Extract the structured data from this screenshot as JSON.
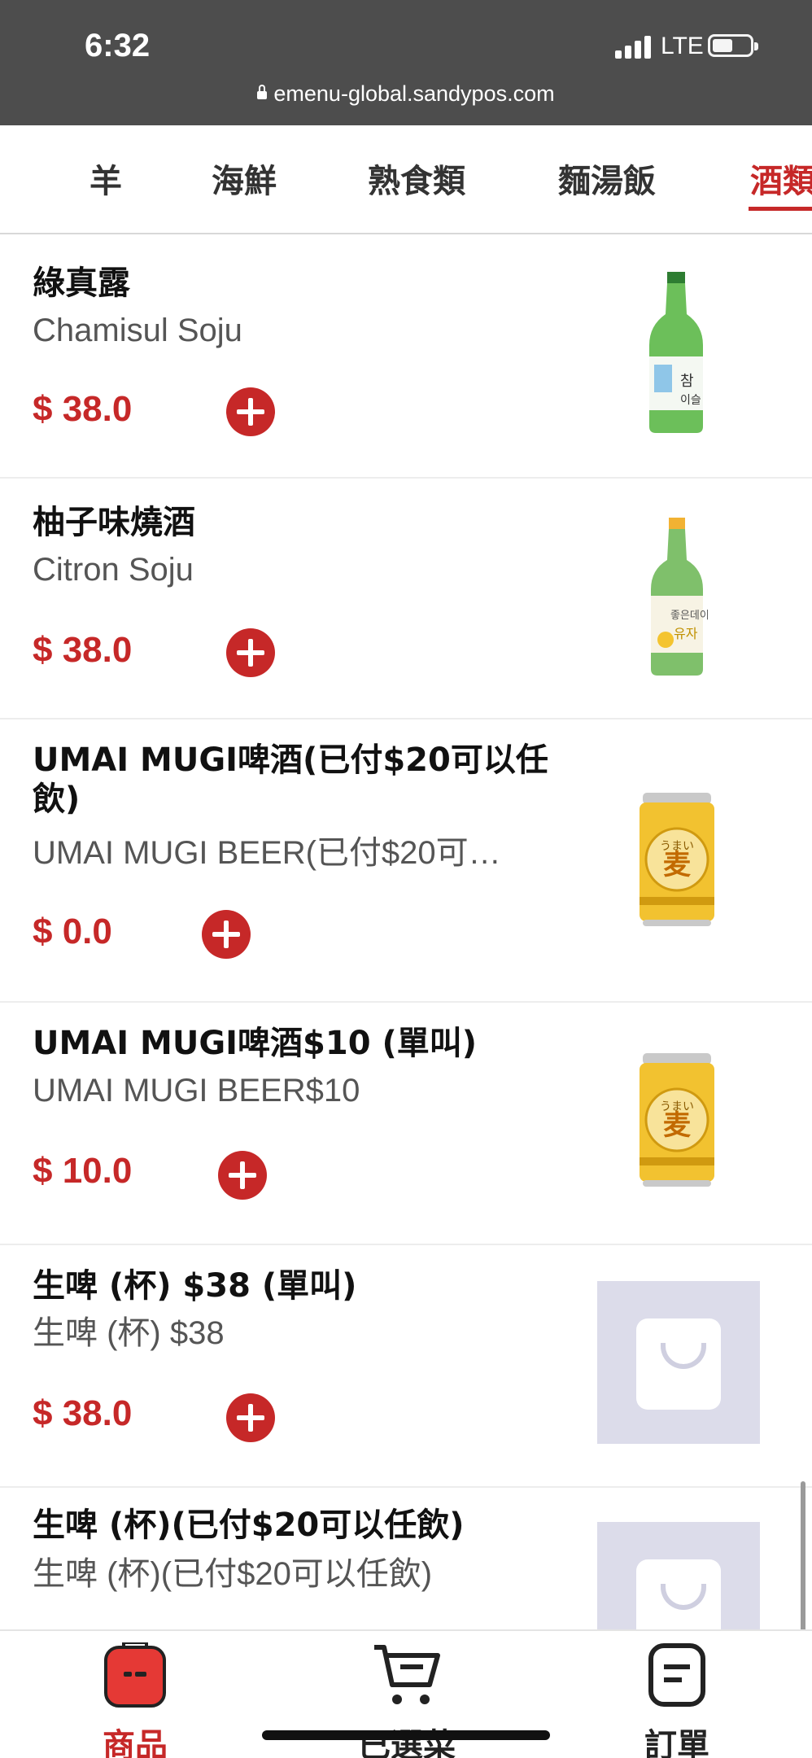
{
  "status_bar": {
    "time": "6:32",
    "network": "LTE",
    "url": "emenu-global.sandypos.com"
  },
  "tabs": [
    {
      "label": "羊"
    },
    {
      "label": "海鮮"
    },
    {
      "label": "熟食類"
    },
    {
      "label": "麵湯飯"
    },
    {
      "label": "酒類"
    }
  ],
  "active_tab": "酒類",
  "items": [
    {
      "name": "綠真露",
      "subname": "Chamisul Soju",
      "price": "$ 38.0",
      "image": "green-soju-bottle"
    },
    {
      "name": "柚子味燒酒",
      "subname": "Citron Soju",
      "price": "$ 38.0",
      "image": "citron-soju-bottle"
    },
    {
      "name": "UMAI MUGI啤酒(已付$20可以任飲)",
      "subname": "UMAI MUGI BEER(已付$20可…",
      "price": "$ 0.0",
      "image": "umai-mugi-beer-can"
    },
    {
      "name": "UMAI MUGI啤酒$10 (單叫)",
      "subname": "UMAI MUGI BEER$10",
      "price": "$ 10.0",
      "image": "umai-mugi-beer-can"
    },
    {
      "name": "生啤 (杯) $38 (單叫)",
      "subname": "生啤 (杯) $38",
      "price": "$ 38.0",
      "image": "placeholder-bag-icon"
    },
    {
      "name": "生啤 (杯)(已付$20可以任飲)",
      "subname": "生啤 (杯)(已付$20可以任飲)",
      "price": "",
      "image": "placeholder-bag-icon"
    }
  ],
  "bottom_nav": [
    {
      "label": "商品",
      "icon": "product-icon",
      "active": true
    },
    {
      "label": "已選菜",
      "icon": "cart-icon",
      "active": false
    },
    {
      "label": "訂單",
      "icon": "order-icon",
      "active": false
    }
  ],
  "colors": {
    "accent": "#c62828",
    "status_bar_bg": "#4d4d4d",
    "placeholder_bg": "#dcdcea"
  }
}
